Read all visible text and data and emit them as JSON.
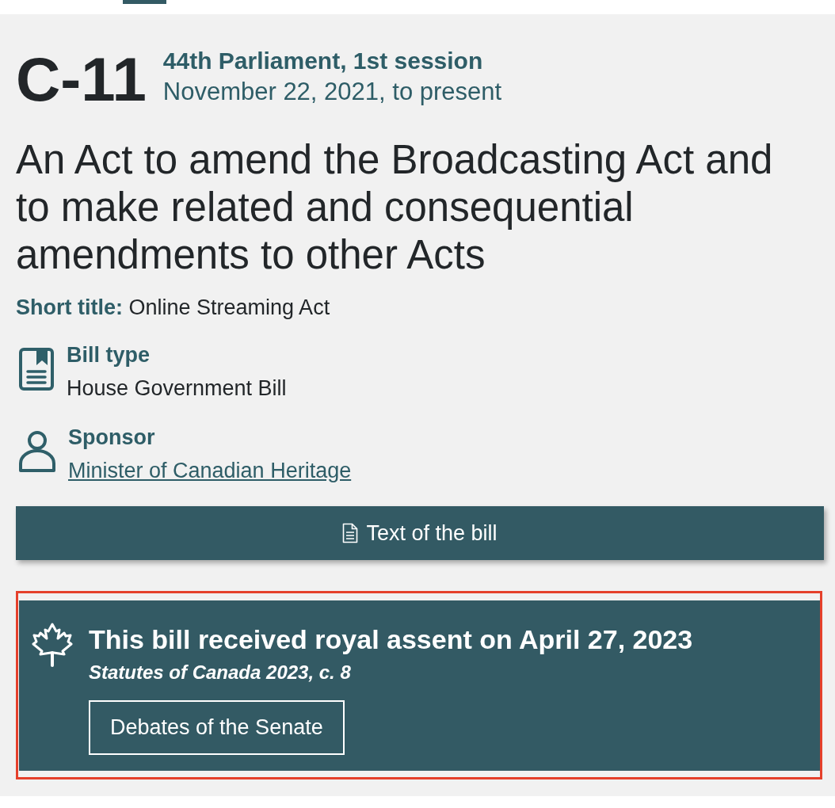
{
  "bill": {
    "number": "C-11",
    "parliament": "44th Parliament, 1st session",
    "dates": "November 22, 2021, to present",
    "long_title": "An Act to amend the Broadcasting Act and to make related and consequential amendments to other Acts",
    "short_title": "**Short title:** Online Streaming Act"
  },
  "details": [
    {
      "kind": "text",
      "label": "Bill type",
      "value": "House Government Bill"
    },
    {
      "kind": "link",
      "label": "Sponsor",
      "value": "Minister of Canadian Heritage"
    }
  ],
  "text_button": {
    "label": "Text of the bill"
  },
  "royal_assent": {
    "highlighted": true,
    "heading": "This bill received royal assent on April 27, 2023",
    "citation": "Statutes of Canada 2023, c. 8",
    "button": "Debates of the Senate"
  }
}
